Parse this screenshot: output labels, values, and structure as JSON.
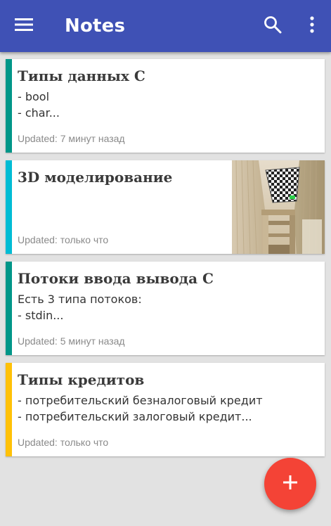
{
  "appbar": {
    "title": "Notes",
    "color": "#3f51b5",
    "icons": [
      "menu-icon",
      "search-icon",
      "more-vert-icon"
    ]
  },
  "notes": [
    {
      "title": " Типы данных С",
      "body": "- bool\n- char...",
      "updated": "Updated: 7 минут назад",
      "color": "#009688",
      "has_image": false
    },
    {
      "title": "3D моделирование",
      "body": "",
      "updated": "Updated: только что",
      "color": "#00bcd4",
      "has_image": true
    },
    {
      "title": "Потоки ввода вывода С",
      "body": "Есть 3 типа потоков:\n- stdin...",
      "updated": "Updated: 5 минут назад",
      "color": "#009688",
      "has_image": false
    },
    {
      "title": "Типы кредитов",
      "body": "- потребительский безналоговый кредит\n- потребительский залоговый кредит...",
      "updated": "Updated: только что",
      "color": "#ffc107",
      "has_image": false
    }
  ],
  "fab": {
    "icon": "plus-icon",
    "color": "#f44336"
  }
}
